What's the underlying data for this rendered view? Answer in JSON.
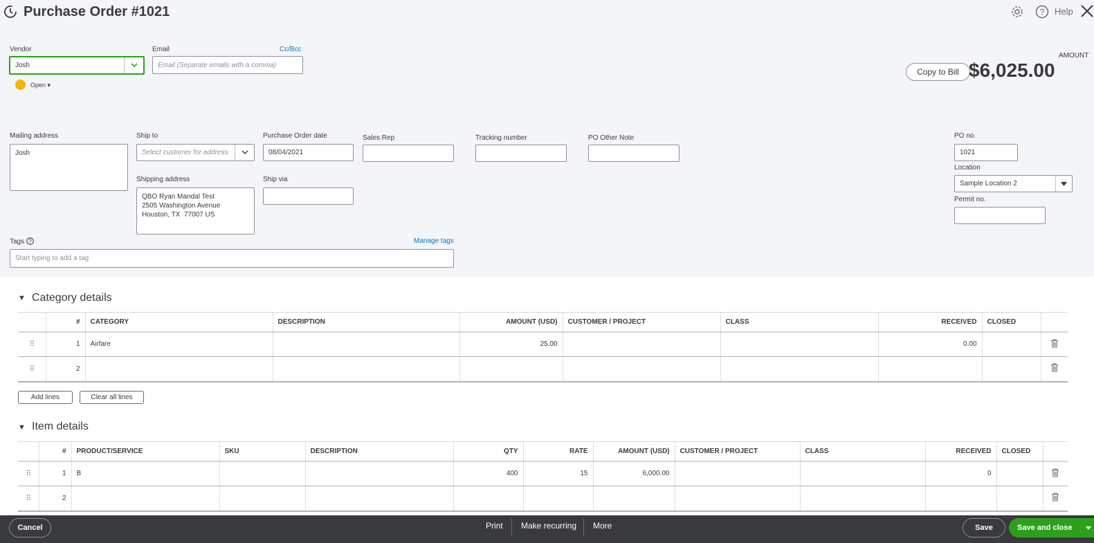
{
  "header": {
    "title": "Purchase Order #1021",
    "help_label": "Help"
  },
  "vendor": {
    "label": "Vendor",
    "value": "Josh",
    "status": "Open"
  },
  "email": {
    "label": "Email",
    "cc_bcc": "Cc/Bcc",
    "placeholder": "Email (Separate emails with a comma)"
  },
  "summary": {
    "amount_label": "AMOUNT",
    "amount": "$6,025.00",
    "copy_to_bill": "Copy to Bill"
  },
  "fields": {
    "mailing_address_label": "Mailing address",
    "mailing_address": "Josh",
    "ship_to_label": "Ship to",
    "ship_to_placeholder": "Select customer for address",
    "shipping_address_label": "Shipping address",
    "shipping_address": "QBO Ryan Mandal Test\n2505 Washington Avenue\nHouston, TX  77007 US",
    "po_date_label": "Purchase Order date",
    "po_date": "08/04/2021",
    "ship_via_label": "Ship via",
    "sales_rep_label": "Sales Rep",
    "tracking_label": "Tracking number",
    "po_other_note_label": "PO Other Note",
    "po_no_label": "PO no.",
    "po_no": "1021",
    "location_label": "Location",
    "location": "Sample Location 2",
    "permit_label": "Permit no.",
    "tags_label": "Tags",
    "manage_tags": "Manage tags",
    "tags_placeholder": "Start typing to add a tag"
  },
  "category": {
    "title": "Category details",
    "headers": [
      "#",
      "CATEGORY",
      "DESCRIPTION",
      "AMOUNT (USD)",
      "CUSTOMER / PROJECT",
      "CLASS",
      "RECEIVED",
      "CLOSED"
    ],
    "rows": [
      {
        "num": "1",
        "category": "Airfare",
        "description": "",
        "amount": "25.00",
        "customer": "",
        "class": "",
        "received": "0.00",
        "closed": ""
      },
      {
        "num": "2",
        "category": "",
        "description": "",
        "amount": "",
        "customer": "",
        "class": "",
        "received": "",
        "closed": ""
      }
    ],
    "add_lines": "Add lines",
    "clear_lines": "Clear all lines"
  },
  "items": {
    "title": "Item details",
    "headers": [
      "#",
      "PRODUCT/SERVICE",
      "SKU",
      "DESCRIPTION",
      "QTY",
      "RATE",
      "AMOUNT (USD)",
      "CUSTOMER / PROJECT",
      "CLASS",
      "RECEIVED",
      "CLOSED"
    ],
    "rows": [
      {
        "num": "1",
        "product": "B",
        "sku": "",
        "description": "",
        "qty": "400",
        "rate": "15",
        "amount": "6,000.00",
        "customer": "",
        "class": "",
        "received": "0",
        "closed": ""
      },
      {
        "num": "2",
        "product": "",
        "sku": "",
        "description": "",
        "qty": "",
        "rate": "",
        "amount": "",
        "customer": "",
        "class": "",
        "received": "",
        "closed": ""
      }
    ]
  },
  "footer": {
    "cancel": "Cancel",
    "print": "Print",
    "make_recurring": "Make recurring",
    "more": "More",
    "save": "Save",
    "save_and_close": "Save and close"
  },
  "colors": {
    "accent_green": "#2ca01c",
    "link_blue": "#0077c5",
    "footer_bg": "#393a3d",
    "status_yellow": "#f4b700"
  }
}
